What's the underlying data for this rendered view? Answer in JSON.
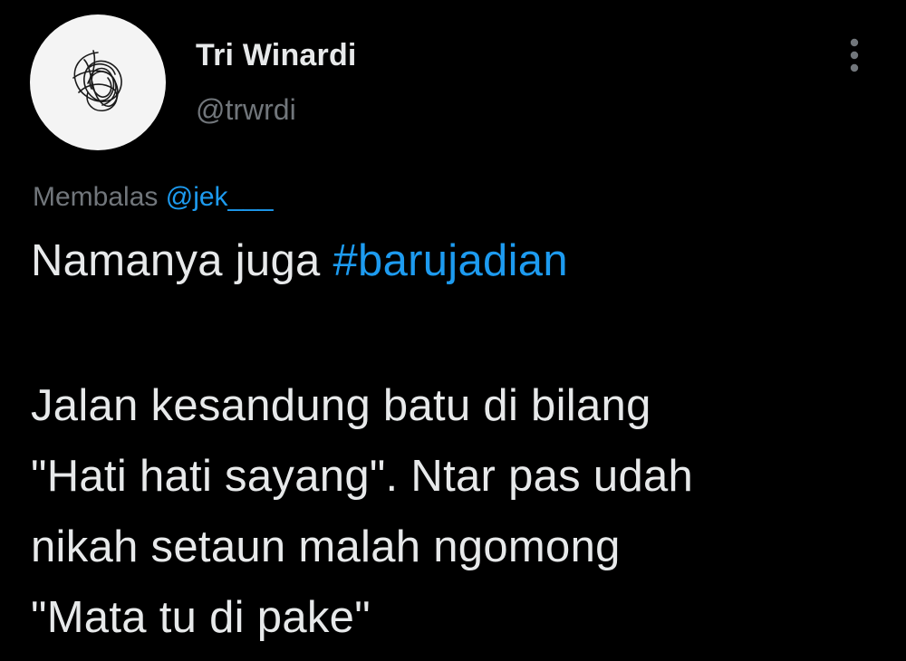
{
  "author": {
    "display_name": "Tri Winardi",
    "handle": "@trwrdi",
    "avatar_icon": "scribble-avatar"
  },
  "more_icon": "vertical-ellipsis-icon",
  "reply_context": {
    "prefix": "Membalas",
    "mention": "@jek___"
  },
  "tweet": {
    "line1_text": "Namanya juga ",
    "line1_hashtag": "#barujadian",
    "line2": "Jalan kesandung batu di bilang",
    "line3": "\"Hati hati sayang\". Ntar pas udah",
    "line4": "nikah setaun malah ngomong",
    "line5": "\"Mata tu di pake\""
  },
  "colors": {
    "background": "#000000",
    "text_primary": "#e7e9ea",
    "text_secondary": "#71767b",
    "accent": "#1d9bf0",
    "avatar_bg": "#f4f4f4"
  }
}
